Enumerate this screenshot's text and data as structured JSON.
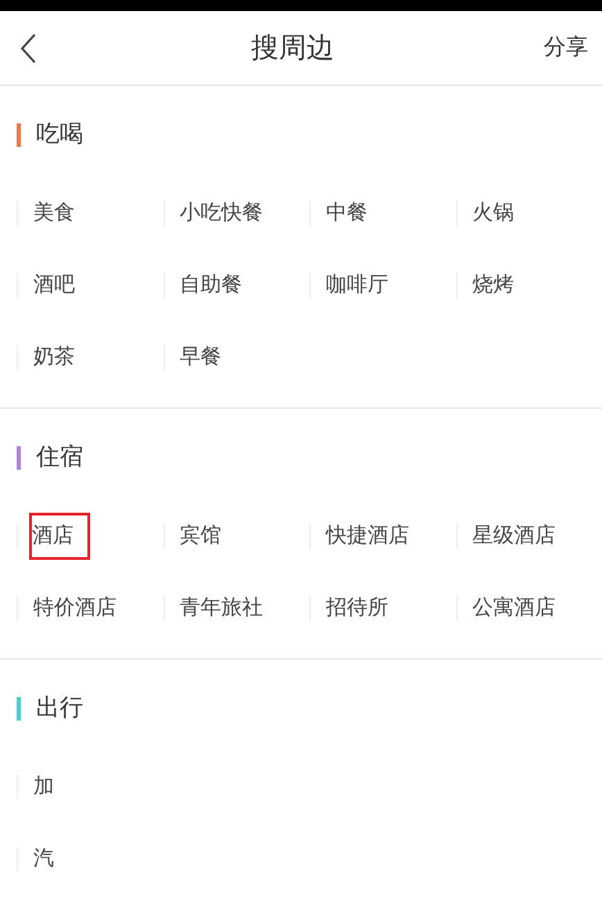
{
  "header": {
    "title": "搜周边",
    "share": "分享"
  },
  "sections": [
    {
      "title": "吃喝",
      "color": "#f5773a",
      "rows": [
        [
          {
            "label": "美食",
            "highlighted": false
          },
          {
            "label": "小吃快餐",
            "highlighted": false
          },
          {
            "label": "中餐",
            "highlighted": false
          },
          {
            "label": "火锅",
            "highlighted": false
          }
        ],
        [
          {
            "label": "酒吧",
            "highlighted": false
          },
          {
            "label": "自助餐",
            "highlighted": false
          },
          {
            "label": "咖啡厅",
            "highlighted": false
          },
          {
            "label": "烧烤",
            "highlighted": false
          }
        ],
        [
          {
            "label": "奶茶",
            "highlighted": false
          },
          {
            "label": "早餐",
            "highlighted": false
          }
        ]
      ]
    },
    {
      "title": "住宿",
      "color": "#b07ee8",
      "rows": [
        [
          {
            "label": "酒店",
            "highlighted": true
          },
          {
            "label": "宾馆",
            "highlighted": false
          },
          {
            "label": "快捷酒店",
            "highlighted": false
          },
          {
            "label": "星级酒店",
            "highlighted": false
          }
        ],
        [
          {
            "label": "特价酒店",
            "highlighted": false
          },
          {
            "label": "青年旅社",
            "highlighted": false
          },
          {
            "label": "招待所",
            "highlighted": false
          },
          {
            "label": "公寓酒店",
            "highlighted": false
          }
        ]
      ]
    },
    {
      "title": "出行",
      "color": "#3ed3cf",
      "rows": [
        [
          {
            "label": "加",
            "highlighted": false
          }
        ],
        [
          {
            "label": "汽",
            "highlighted": false
          }
        ]
      ]
    }
  ]
}
